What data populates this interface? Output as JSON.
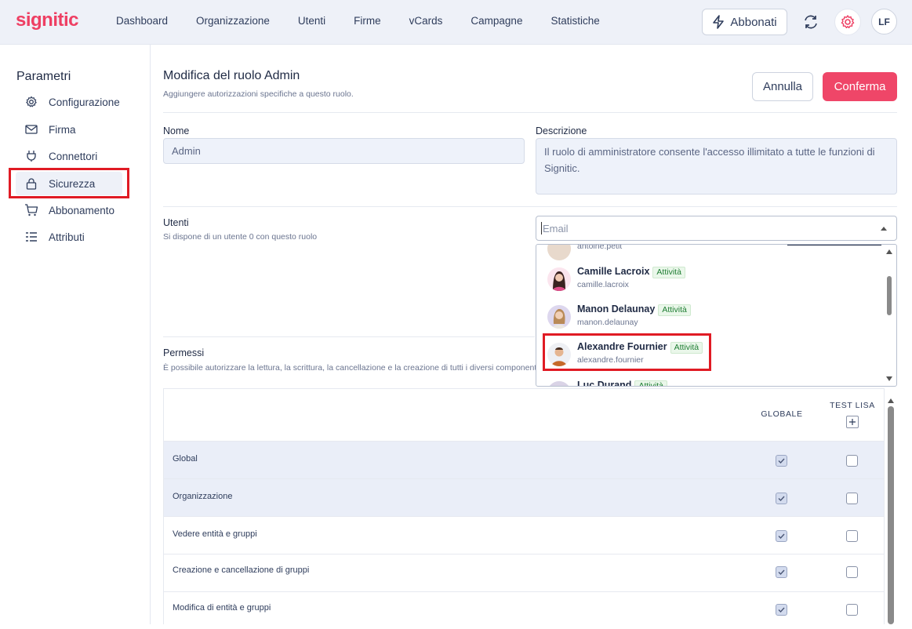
{
  "header": {
    "logo": "signitic",
    "nav": [
      "Dashboard",
      "Organizzazione",
      "Utenti",
      "Firme",
      "vCards",
      "Campagne",
      "Statistiche"
    ],
    "abbonati_label": "Abbonati",
    "user_initials": "LF"
  },
  "sidebar": {
    "title": "Parametri",
    "items": [
      {
        "label": "Configurazione",
        "icon": "gear-icon"
      },
      {
        "label": "Firma",
        "icon": "envelope-icon"
      },
      {
        "label": "Connettori",
        "icon": "plug-icon"
      },
      {
        "label": "Sicurezza",
        "icon": "lock-icon"
      },
      {
        "label": "Abbonamento",
        "icon": "cart-icon"
      },
      {
        "label": "Attributi",
        "icon": "list-icon"
      }
    ],
    "active": "Sicurezza"
  },
  "main": {
    "title": "Modifica del ruolo Admin",
    "subtitle": "Aggiungere autorizzazioni specifiche a questo ruolo.",
    "cancel_label": "Annulla",
    "confirm_label": "Conferma",
    "name_label": "Nome",
    "name_value": "Admin",
    "description_label": "Descrizione",
    "description_value": "Il ruolo di amministratore consente l'accesso illimitato a tutte le funzioni di Signitic.",
    "users_label": "Utenti",
    "users_help": "Si dispone di un utente 0 con questo ruolo",
    "email_placeholder": "Email",
    "permissions_label": "Permessi",
    "permissions_help": "È possibile autorizzare la lettura, la scrittura, la cancellazione e la creazione di tutti i diversi component"
  },
  "dropdown": {
    "partial_top_email": "antoine.petit",
    "users": [
      {
        "name": "Camille Lacroix",
        "badge": "Attività",
        "email": "camille.lacroix"
      },
      {
        "name": "Manon Delaunay",
        "badge": "Attività",
        "email": "manon.delaunay"
      },
      {
        "name": "Alexandre Fournier",
        "badge": "Attività",
        "email": "alexandre.fournier"
      },
      {
        "name": "Luc Durand",
        "badge": "Attività",
        "email": ""
      }
    ]
  },
  "permissions_table": {
    "col_global": "GLOBALE",
    "col_group": "TEST LISA",
    "rows": [
      {
        "label": "Global",
        "global": true,
        "group": false,
        "highlight": true
      },
      {
        "label": "Organizzazione",
        "global": true,
        "group": false,
        "highlight": true
      },
      {
        "label": "Vedere entità e gruppi",
        "global": true,
        "group": false,
        "highlight": false
      },
      {
        "label": "Creazione e cancellazione di gruppi",
        "global": true,
        "group": false,
        "highlight": false
      },
      {
        "label": "Modifica di entità e gruppi",
        "global": true,
        "group": false,
        "highlight": false
      }
    ]
  }
}
